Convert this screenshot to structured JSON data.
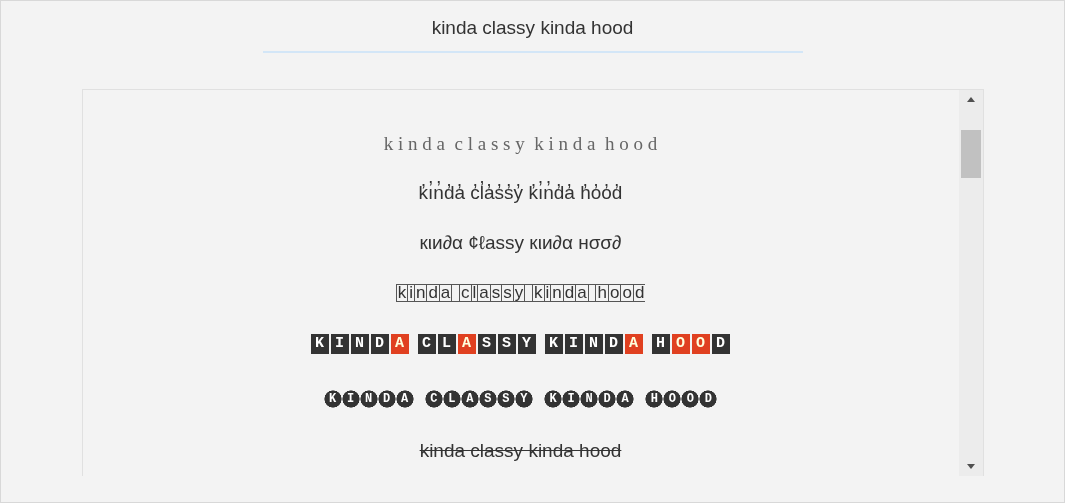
{
  "input": {
    "value": "kinda classy kinda hood"
  },
  "results": [
    {
      "kind": "spaced",
      "text": "k i n d a  c l a s s y  k i n d a  h o o d"
    },
    {
      "kind": "plain",
      "text": "k̓ı̓n̓d̓a̓ c̓l̓a̓s̓s̓y̓ k̓ı̓n̓d̓a̓ h̓o̓o̓d̓"
    },
    {
      "kind": "plain",
      "text": "кιи∂α ¢ℓassy кιи∂α нσσ∂"
    },
    {
      "kind": "outlined",
      "text": "kinda classy kinda hood"
    },
    {
      "kind": "tiles",
      "words": [
        {
          "segments": [
            {
              "text": "KIND",
              "highlighted": false
            },
            {
              "text": "A",
              "highlighted": true
            }
          ]
        },
        {
          "segments": [
            {
              "text": "CL",
              "highlighted": false
            },
            {
              "text": "A",
              "highlighted": true
            },
            {
              "text": "SSY",
              "highlighted": false
            }
          ]
        },
        {
          "segments": [
            {
              "text": "KIND",
              "highlighted": false
            },
            {
              "text": "A",
              "highlighted": true
            }
          ]
        },
        {
          "segments": [
            {
              "text": "H",
              "highlighted": false
            },
            {
              "text": "O",
              "highlighted": true
            },
            {
              "text": "O",
              "highlighted": true
            },
            {
              "text": "D",
              "highlighted": false
            }
          ]
        }
      ]
    },
    {
      "kind": "circled",
      "text": "KINDA CLASSY KINDA HOOD"
    },
    {
      "kind": "strike",
      "text": "kinda classy kinda hood"
    }
  ]
}
